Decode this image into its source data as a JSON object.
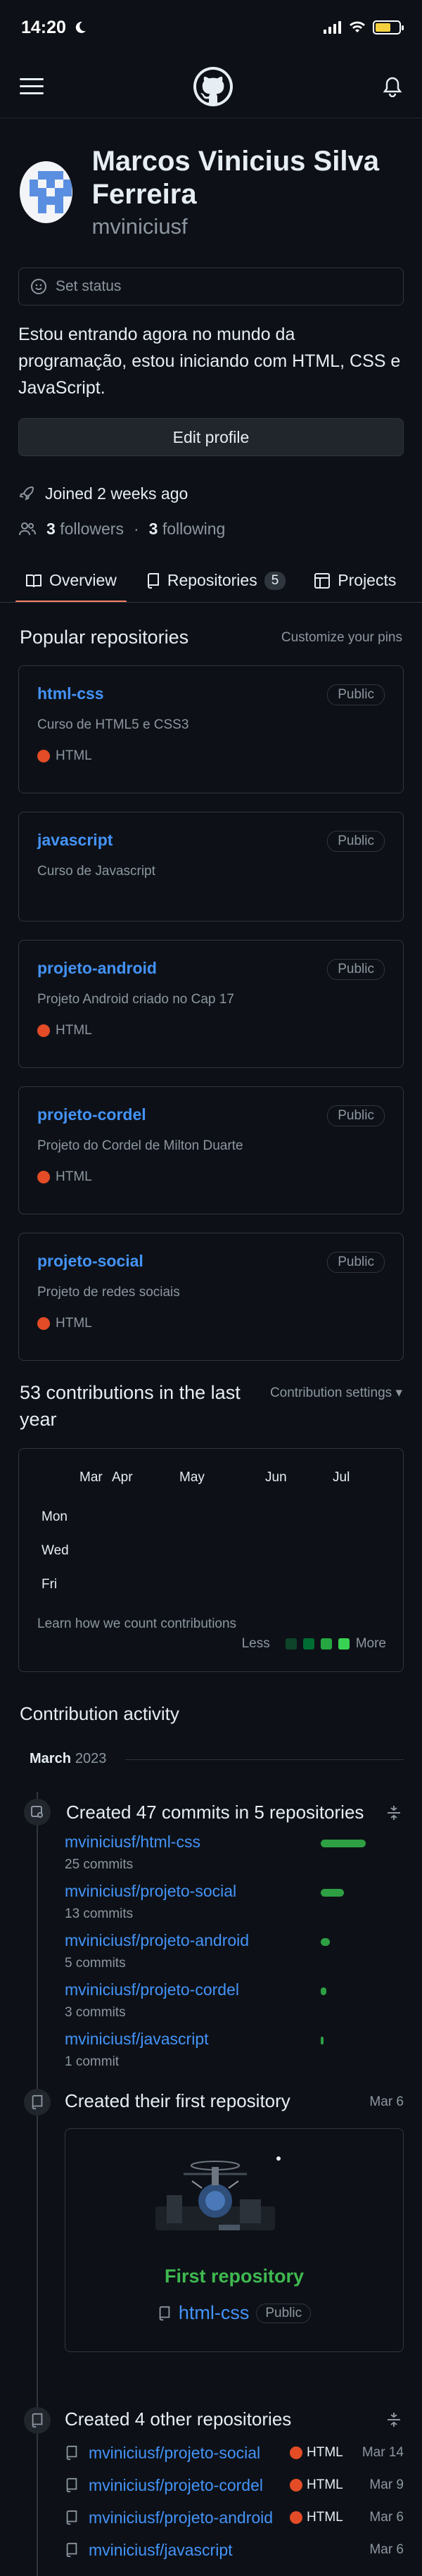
{
  "status_bar": {
    "time": "14:20"
  },
  "profile": {
    "name": "Marcos Vinicius Silva Ferreira",
    "login": "mviniciusf",
    "set_status": "Set status",
    "bio": "Estou entrando agora no mundo da programação, estou iniciando com HTML, CSS e JavaScript.",
    "edit_button": "Edit profile",
    "joined": "Joined 2 weeks ago",
    "followers_count": "3",
    "followers_label": "followers",
    "separator": "·",
    "following_count": "3",
    "following_label": "following"
  },
  "tabs": [
    {
      "label": "Overview"
    },
    {
      "label": "Repositories",
      "count": "5"
    },
    {
      "label": "Projects"
    }
  ],
  "popular": {
    "title": "Popular repositories",
    "customize": "Customize your pins",
    "repos": [
      {
        "name": "html-css",
        "visibility": "Public",
        "description": "Curso de HTML5 e CSS3",
        "language": "HTML"
      },
      {
        "name": "javascript",
        "visibility": "Public",
        "description": "Curso de Javascript",
        "language": ""
      },
      {
        "name": "projeto-android",
        "visibility": "Public",
        "description": "Projeto Android criado no Cap 17",
        "language": "HTML"
      },
      {
        "name": "projeto-cordel",
        "visibility": "Public",
        "description": "Projeto do Cordel de Milton Duarte",
        "language": "HTML"
      },
      {
        "name": "projeto-social",
        "visibility": "Public",
        "description": "Projeto de redes sociais",
        "language": "HTML"
      }
    ]
  },
  "contributions": {
    "title": "53 contributions in the last year",
    "settings": "Contribution settings",
    "months": [
      "Mar",
      "Apr",
      "May",
      "Jun",
      "Jul"
    ],
    "days": [
      "Mon",
      "Wed",
      "Fri"
    ],
    "learn": "Learn how we count contributions",
    "less": "Less",
    "more": "More",
    "legend_colors": [
      "#0e4429",
      "#006d32",
      "#26a641",
      "#39d353"
    ]
  },
  "activity": {
    "title": "Contribution activity",
    "month": "March",
    "year": "2023",
    "commits": {
      "title": "Created 47 commits in 5 repositories",
      "repos": [
        {
          "name": "mviniciusf/html-css",
          "count": "25 commits",
          "share": 25
        },
        {
          "name": "mviniciusf/projeto-social",
          "count": "13 commits",
          "share": 13
        },
        {
          "name": "mviniciusf/projeto-android",
          "count": "5 commits",
          "share": 5
        },
        {
          "name": "mviniciusf/projeto-cordel",
          "count": "3 commits",
          "share": 3
        },
        {
          "name": "mviniciusf/javascript",
          "count": "1 commit",
          "share": 1
        }
      ]
    },
    "first_repo": {
      "title": "Created their first repository",
      "date": "Mar 6",
      "card_title": "First repository",
      "repo": "html-css",
      "visibility": "Public"
    },
    "other_repos": {
      "title": "Created 4 other repositories",
      "repos": [
        {
          "name": "mviniciusf/projeto-social",
          "language": "HTML",
          "date": "Mar 14"
        },
        {
          "name": "mviniciusf/projeto-cordel",
          "language": "HTML",
          "date": "Mar 9"
        },
        {
          "name": "mviniciusf/projeto-android",
          "language": "HTML",
          "date": "Mar 6"
        },
        {
          "name": "mviniciusf/javascript",
          "language": "",
          "date": "Mar 6"
        }
      ]
    }
  }
}
